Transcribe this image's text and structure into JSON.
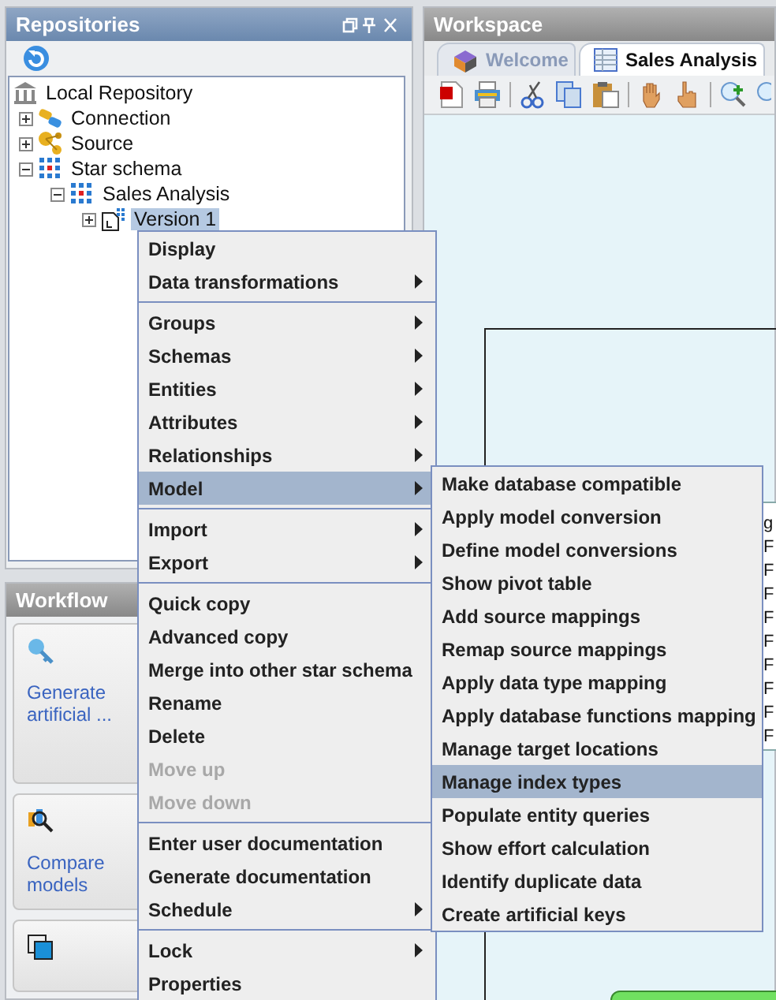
{
  "repositories": {
    "title": "Repositories",
    "tree": [
      {
        "label": "Local Repository",
        "selected": false,
        "children": [
          {
            "label": "Connection",
            "expanded": false,
            "selected": false
          },
          {
            "label": "Source",
            "expanded": false,
            "selected": false
          },
          {
            "label": "Star schema",
            "expanded": true,
            "selected": false,
            "children": [
              {
                "label": "Sales Analysis",
                "expanded": true,
                "selected": false,
                "children": [
                  {
                    "label": "Version 1",
                    "expanded": false,
                    "selected": true
                  }
                ]
              }
            ]
          }
        ]
      }
    ]
  },
  "workflow": {
    "title": "Workflow",
    "cards": [
      {
        "label": "Generate artificial ..."
      },
      {
        "label": "Compare models"
      }
    ]
  },
  "workspace": {
    "title": "Workspace",
    "tabs": [
      {
        "label": "Welcome",
        "selected": false
      },
      {
        "label": "Sales Analysis",
        "selected": true
      }
    ],
    "canvas_fragments": [
      "g",
      "F",
      "F",
      "F",
      "F",
      "F",
      "F",
      "F",
      "F",
      "F"
    ]
  },
  "context_menu": {
    "groups": [
      [
        {
          "label": "Display",
          "disabled": false,
          "submenu": false,
          "selected": false
        },
        {
          "label": "Data transformations",
          "disabled": false,
          "submenu": true,
          "selected": false
        }
      ],
      [
        {
          "label": "Groups",
          "disabled": false,
          "submenu": true,
          "selected": false
        },
        {
          "label": "Schemas",
          "disabled": false,
          "submenu": true,
          "selected": false
        },
        {
          "label": "Entities",
          "disabled": false,
          "submenu": true,
          "selected": false
        },
        {
          "label": "Attributes",
          "disabled": false,
          "submenu": true,
          "selected": false
        },
        {
          "label": "Relationships",
          "disabled": false,
          "submenu": true,
          "selected": false
        },
        {
          "label": "Model",
          "disabled": false,
          "submenu": true,
          "selected": true
        }
      ],
      [
        {
          "label": "Import",
          "disabled": false,
          "submenu": true,
          "selected": false
        },
        {
          "label": "Export",
          "disabled": false,
          "submenu": true,
          "selected": false
        }
      ],
      [
        {
          "label": "Quick copy",
          "disabled": false,
          "submenu": false,
          "selected": false
        },
        {
          "label": "Advanced copy",
          "disabled": false,
          "submenu": false,
          "selected": false
        },
        {
          "label": "Merge into other star schema",
          "disabled": false,
          "submenu": false,
          "selected": false
        },
        {
          "label": "Rename",
          "disabled": false,
          "submenu": false,
          "selected": false
        },
        {
          "label": "Delete",
          "disabled": false,
          "submenu": false,
          "selected": false
        },
        {
          "label": "Move up",
          "disabled": true,
          "submenu": false,
          "selected": false
        },
        {
          "label": "Move down",
          "disabled": true,
          "submenu": false,
          "selected": false
        }
      ],
      [
        {
          "label": "Enter user documentation",
          "disabled": false,
          "submenu": false,
          "selected": false
        },
        {
          "label": "Generate documentation",
          "disabled": false,
          "submenu": false,
          "selected": false
        },
        {
          "label": "Schedule",
          "disabled": false,
          "submenu": true,
          "selected": false
        }
      ],
      [
        {
          "label": "Lock",
          "disabled": false,
          "submenu": true,
          "selected": false
        },
        {
          "label": "Properties",
          "disabled": false,
          "submenu": false,
          "selected": false
        }
      ]
    ]
  },
  "submenu": {
    "items": [
      {
        "label": "Make database compatible",
        "selected": false
      },
      {
        "label": "Apply model conversion",
        "selected": false
      },
      {
        "label": "Define model conversions",
        "selected": false
      },
      {
        "label": "Show pivot table",
        "selected": false
      },
      {
        "label": "Add source mappings",
        "selected": false
      },
      {
        "label": "Remap source mappings",
        "selected": false
      },
      {
        "label": "Apply data type mapping",
        "selected": false
      },
      {
        "label": "Apply database functions mapping",
        "selected": false
      },
      {
        "label": "Manage target locations",
        "selected": false
      },
      {
        "label": "Manage index types",
        "selected": true
      },
      {
        "label": "Populate entity queries",
        "selected": false
      },
      {
        "label": "Show effort calculation",
        "selected": false
      },
      {
        "label": "Identify duplicate data",
        "selected": false
      },
      {
        "label": "Create artificial keys",
        "selected": false
      }
    ]
  }
}
